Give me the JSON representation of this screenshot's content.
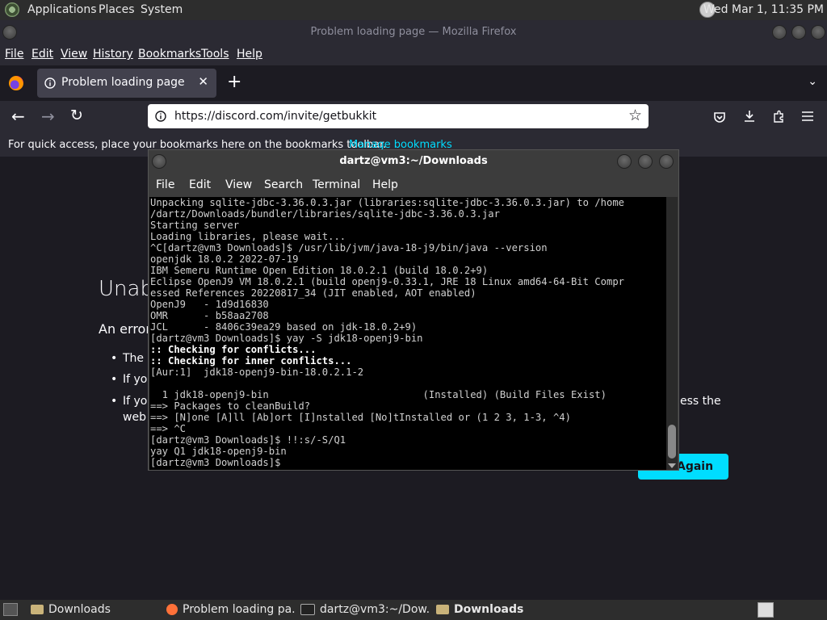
{
  "top_panel": {
    "menus": [
      "Applications",
      "Places",
      "System"
    ],
    "clock": "Wed Mar  1, 11:35 PM"
  },
  "firefox": {
    "window_title": "Problem loading page — Mozilla Firefox",
    "menubar": [
      "File",
      "Edit",
      "View",
      "History",
      "Bookmarks",
      "Tools",
      "Help"
    ],
    "tab_title": "Problem loading page",
    "url": "https://discord.com/invite/getbukkit",
    "bookmarks_hint": "For quick access, place your bookmarks here on the bookmarks toolbar.",
    "manage_bookmarks": "Manage bookmarks",
    "error_heading_partial": "Unab",
    "error_intro_partial": "An error",
    "bullets_partial": [
      "The s",
      "If you",
      "If you",
      "web"
    ],
    "bullet_right_partial": "ess the",
    "try_again_partial": "Again"
  },
  "terminal": {
    "title": "dartz@vm3:~/Downloads",
    "menu": [
      "File",
      "Edit",
      "View",
      "Search",
      "Terminal",
      "Help"
    ],
    "lines": [
      "Unpacking sqlite-jdbc-3.36.0.3.jar (libraries:sqlite-jdbc-3.36.0.3.jar) to /home",
      "/dartz/Downloads/bundler/libraries/sqlite-jdbc-3.36.0.3.jar",
      "Starting server",
      "Loading libraries, please wait...",
      "^C[dartz@vm3 Downloads]$ /usr/lib/jvm/java-18-j9/bin/java --version",
      "openjdk 18.0.2 2022-07-19",
      "IBM Semeru Runtime Open Edition 18.0.2.1 (build 18.0.2+9)",
      "Eclipse OpenJ9 VM 18.0.2.1 (build openj9-0.33.1, JRE 18 Linux amd64-64-Bit Compr",
      "essed References 20220817_34 (JIT enabled, AOT enabled)",
      "OpenJ9   - 1d9d16830",
      "OMR      - b58aa2708",
      "JCL      - 8406c39ea29 based on jdk-18.0.2+9)",
      "[dartz@vm3 Downloads]$ yay -S jdk18-openj9-bin",
      ":: Checking for conflicts...",
      ":: Checking for inner conflicts...",
      "[Aur:1]  jdk18-openj9-bin-18.0.2.1-2",
      "",
      "  1 jdk18-openj9-bin                          (Installed) (Build Files Exist)",
      "==> Packages to cleanBuild?",
      "==> [N]one [A]ll [Ab]ort [I]nstalled [No]tInstalled or (1 2 3, 1-3, ^4)",
      "==> ^C",
      "[dartz@vm3 Downloads]$ !!:s/-S/Q1",
      "yay Q1 jdk18-openj9-bin",
      "[dartz@vm3 Downloads]$ "
    ]
  },
  "taskbar": {
    "items": [
      "Downloads",
      "Problem loading pa...",
      "dartz@vm3:~/Dow...",
      "Downloads"
    ]
  },
  "colors": {
    "accent": "#00ddff",
    "link": "#00ddff",
    "panel": "#2d2d2d"
  }
}
